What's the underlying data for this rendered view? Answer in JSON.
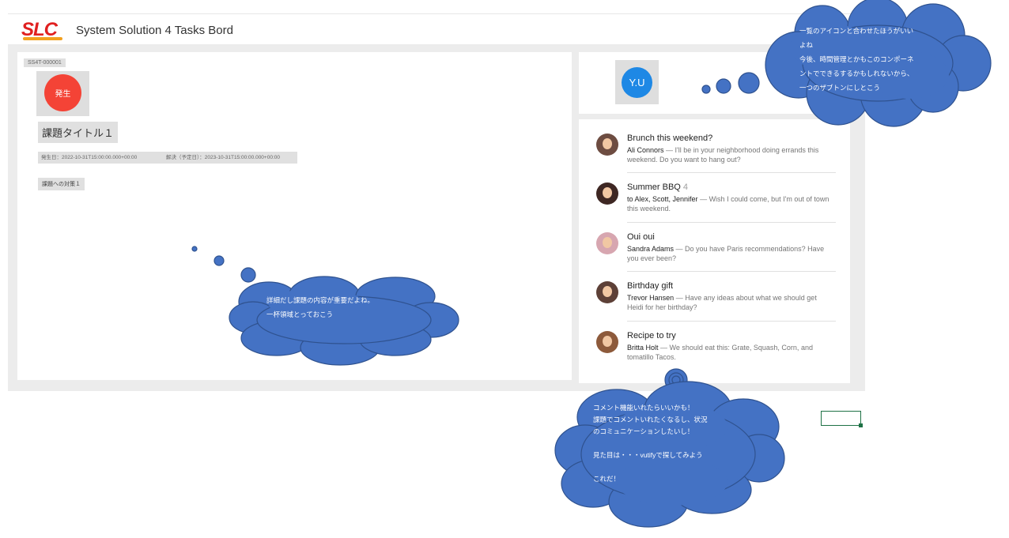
{
  "header": {
    "logo_text": "SLC",
    "title": "System Solution 4 Tasks Bord"
  },
  "task": {
    "id": "SS4T-000001",
    "status": "発生",
    "title": "課題タイトル１",
    "occurrence": "発生日：2022-10-31T15:00:00.000+00:00",
    "resolution": "解決（予定日）：2023-10-31T15:00:00.000+00:00",
    "measure": "課題への対策１"
  },
  "user": {
    "initials": "Y.U"
  },
  "messages": [
    {
      "title": "Brunch this weekend?",
      "count": "",
      "sender": "Ali Connors",
      "text": " — I'll be in your neighborhood doing errands this weekend. Do you want to hang out?"
    },
    {
      "title": "Summer BBQ",
      "count": "4",
      "sender": "to Alex, Scott, Jennifer",
      "text": " — Wish I could come, but I'm out of town this weekend."
    },
    {
      "title": "Oui oui",
      "count": "",
      "sender": "Sandra Adams",
      "text": " — Do you have Paris recommendations? Have you ever been?"
    },
    {
      "title": "Birthday gift",
      "count": "",
      "sender": "Trevor Hansen",
      "text": " — Have any ideas about what we should get Heidi for her birthday?"
    },
    {
      "title": "Recipe to try",
      "count": "",
      "sender": "Britta Holt",
      "text": " — We should eat this: Grate, Squash, Corn, and tomatillo Tacos."
    }
  ],
  "notes": {
    "top_right": [
      "一覧のアイコンと合わせたほうがいい",
      "よね",
      "今後、時間管理とかもこのコンポーネ",
      "ントでできるするかもしれないから、",
      "一つのザブトンにしとこう"
    ],
    "center": [
      "詳細だし課題の内容が重要だよね。",
      "一杯領域とっておこう"
    ],
    "bottom": [
      "コメント機能いれたらいいかも！",
      "課題でコメントいれたくなるし、状況",
      "のコミュニケーションしたいし！",
      "",
      "見た目は・・・vutifyで探してみよう",
      "",
      "これだ！"
    ]
  },
  "colors": {
    "accent": "#1e88e5",
    "status": "#f44336",
    "bubble": "#4472c4",
    "bubble_border": "#2f528f"
  }
}
